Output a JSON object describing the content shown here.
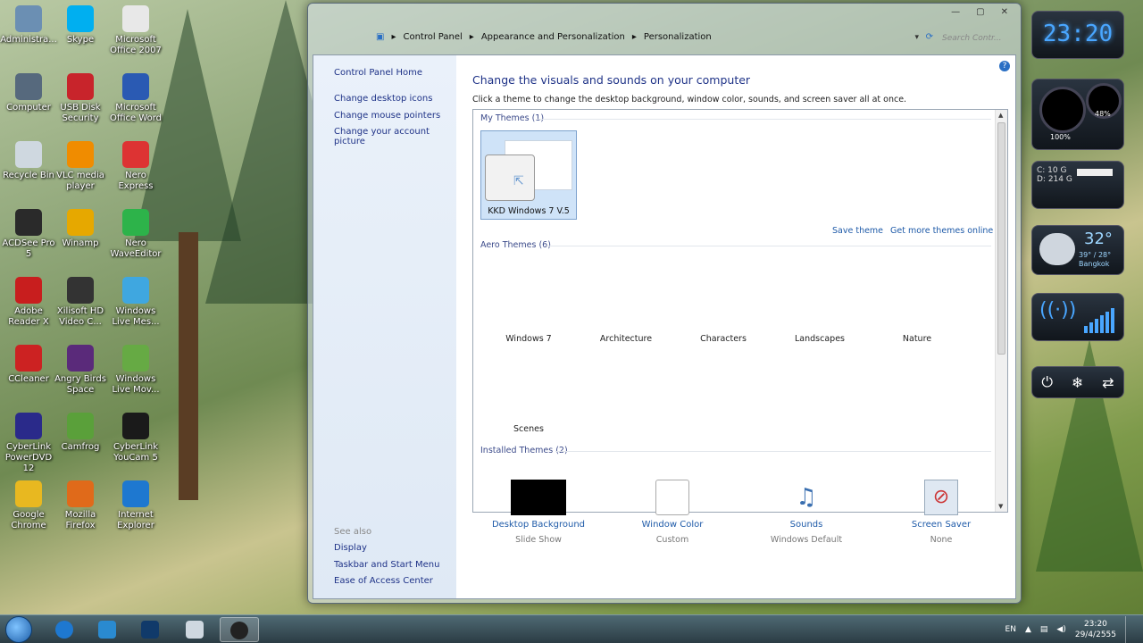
{
  "desktop": {
    "icons": [
      {
        "label": "Administra...",
        "color": "#6b8fb3"
      },
      {
        "label": "Skype",
        "color": "#00aff0"
      },
      {
        "label": "Microsoft Office 2007",
        "color": "#e8e8e8"
      },
      {
        "label": "Computer",
        "color": "#56697d"
      },
      {
        "label": "USB Disk Security",
        "color": "#c8242b"
      },
      {
        "label": "Microsoft Office Word",
        "color": "#2a5ab3"
      },
      {
        "label": "Recycle Bin",
        "color": "#cfd8e0"
      },
      {
        "label": "VLC media player",
        "color": "#f08c00"
      },
      {
        "label": "Nero Express",
        "color": "#d33"
      },
      {
        "label": "ACDSee Pro 5",
        "color": "#2a2a2a"
      },
      {
        "label": "Winamp",
        "color": "#e6a800"
      },
      {
        "label": "Nero WaveEditor",
        "color": "#2db34a"
      },
      {
        "label": "Adobe Reader X",
        "color": "#c81e1e"
      },
      {
        "label": "Xilisoft HD Video C...",
        "color": "#333"
      },
      {
        "label": "Windows Live Mes...",
        "color": "#3fa7e0"
      },
      {
        "label": "CCleaner",
        "color": "#c22"
      },
      {
        "label": "Angry Birds Space",
        "color": "#5a2a7a"
      },
      {
        "label": "Windows Live Mov...",
        "color": "#6a4"
      },
      {
        "label": "CyberLink PowerDVD 12",
        "color": "#2a2a8a"
      },
      {
        "label": "Camfrog",
        "color": "#5aa03a"
      },
      {
        "label": "CyberLink YouCam 5",
        "color": "#1a1a1a"
      },
      {
        "label": "Google Chrome",
        "color": "#e8b820"
      },
      {
        "label": "Mozilla Firefox",
        "color": "#e06a1a"
      },
      {
        "label": "Internet Explorer",
        "color": "#1e78d0"
      }
    ]
  },
  "window": {
    "controls": [
      "—",
      "▢",
      "✕"
    ],
    "breadcrumb": [
      "Control Panel",
      "Appearance and Personalization",
      "Personalization"
    ],
    "search_placeholder": "Search Contr..."
  },
  "leftnav": {
    "home": "Control Panel Home",
    "links": [
      "Change desktop icons",
      "Change mouse pointers",
      "Change your account picture"
    ],
    "see_also": "See also",
    "see_also_links": [
      "Display",
      "Taskbar and Start Menu",
      "Ease of Access Center"
    ]
  },
  "main": {
    "title": "Change the visuals and sounds on your computer",
    "description": "Click a theme to change the desktop background, window color, sounds, and screen saver all at once.",
    "my_themes": "My Themes (1)",
    "selected_theme": "KKD Windows 7 V.5",
    "save_theme": "Save theme",
    "more_themes": "Get more themes online",
    "aero_themes": "Aero Themes (6)",
    "aero_list": [
      "Windows 7",
      "Architecture",
      "Characters",
      "Landscapes",
      "Nature",
      "Scenes"
    ],
    "installed_themes": "Installed Themes (2)"
  },
  "bottom": [
    {
      "label": "Desktop Background",
      "sub": "Slide Show",
      "color": "#000000"
    },
    {
      "label": "Window Color",
      "sub": "Custom",
      "color": "#ffffff"
    },
    {
      "label": "Sounds",
      "sub": "Windows Default",
      "color": "#3a6fb0"
    },
    {
      "label": "Screen Saver",
      "sub": "None",
      "color": "#c8d8e8"
    }
  ],
  "gadgets": {
    "clock": "23:20",
    "cpu": "100%",
    "ram": "48%",
    "disk_c": "C: 10 G",
    "disk_d": "D: 214 G",
    "temp": "32°",
    "range": "39° / 28°",
    "city": "Bangkok"
  },
  "taskbar": {
    "lang": "EN",
    "time": "23:20",
    "date": "29/4/2555"
  }
}
